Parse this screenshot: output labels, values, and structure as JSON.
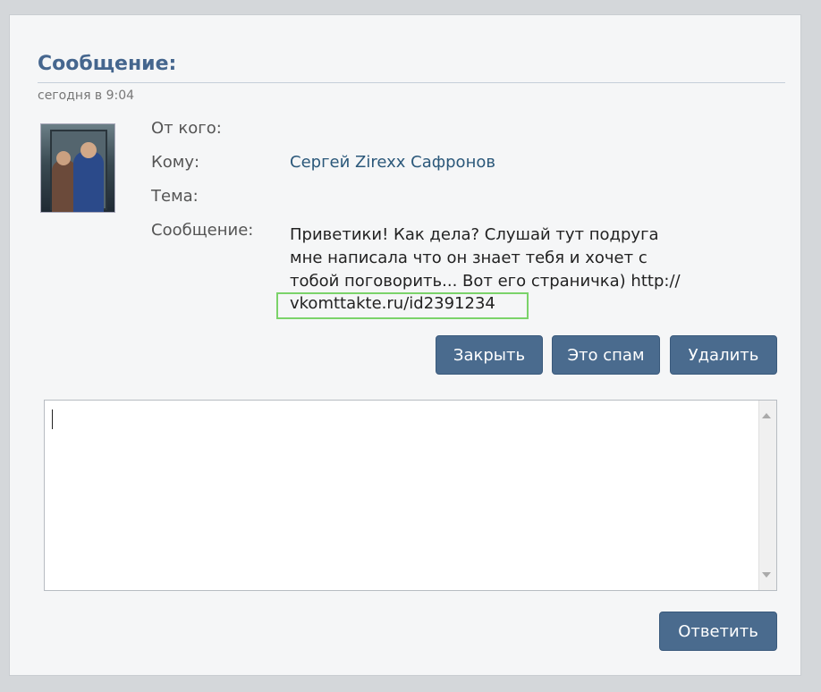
{
  "dialog": {
    "title": "Сообщение:",
    "date": "сегодня в 9:04"
  },
  "fields": {
    "from_label": "От кого:",
    "to_label": "Кому:",
    "to_value": "Сергей Zirexx Сафронов",
    "subject_label": "Тема:",
    "message_label": "Сообщение:",
    "message_lines": [
      "Приветики! Как дела? Слушай тут подруга",
      "мне написала что он знает тебя и хочет с",
      "тобой поговорить... Вот его страничка) http://"
    ],
    "message_url": "vkomttakte.ru/id2391234"
  },
  "buttons": {
    "close": "Закрыть",
    "spam": "Это спам",
    "delete": "Удалить",
    "reply": "Ответить"
  },
  "reply_box": {
    "value": ""
  },
  "colors": {
    "accent": "#45668e",
    "button": "#4a6b8e",
    "highlight_box": "#7bd36a"
  }
}
